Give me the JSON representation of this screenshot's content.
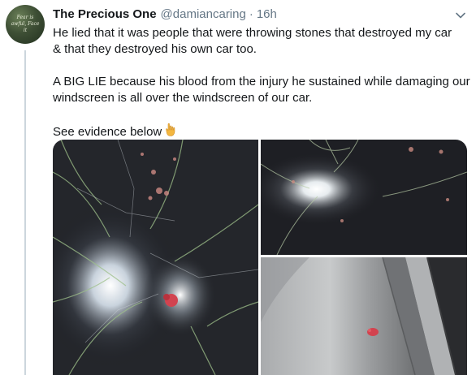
{
  "tweet": {
    "author": {
      "display_name": "The Precious One",
      "handle": "@damiancaring",
      "avatar_text": "Fear is awful, Face it"
    },
    "separator": "·",
    "timestamp": "16h",
    "text": {
      "paragraph_1_line_1": "He lied that it was people that were throwing stones that destroyed my car",
      "paragraph_1_line_2": "& that they destroyed his own car too.",
      "paragraph_2_line_1": "A BIG LIE because his blood from the injury he sustained while damaging our",
      "paragraph_2_line_2": "windscreen is all over the windscreen of our car.",
      "paragraph_3": "See evidence below"
    },
    "emoji": "pointing-down-hand",
    "media": [
      {
        "name": "cracked-windscreen-photo-large",
        "description_icon": "photo"
      },
      {
        "name": "cracked-windscreen-photo-night",
        "description_icon": "photo"
      },
      {
        "name": "car-pillar-blood-photo",
        "description_icon": "photo"
      }
    ]
  },
  "icons": {
    "caret": "chevron-down-icon"
  },
  "colors": {
    "text_primary": "#14171a",
    "text_secondary": "#657786",
    "thread_line": "#ccd6dd",
    "blood": "#d2434f"
  }
}
